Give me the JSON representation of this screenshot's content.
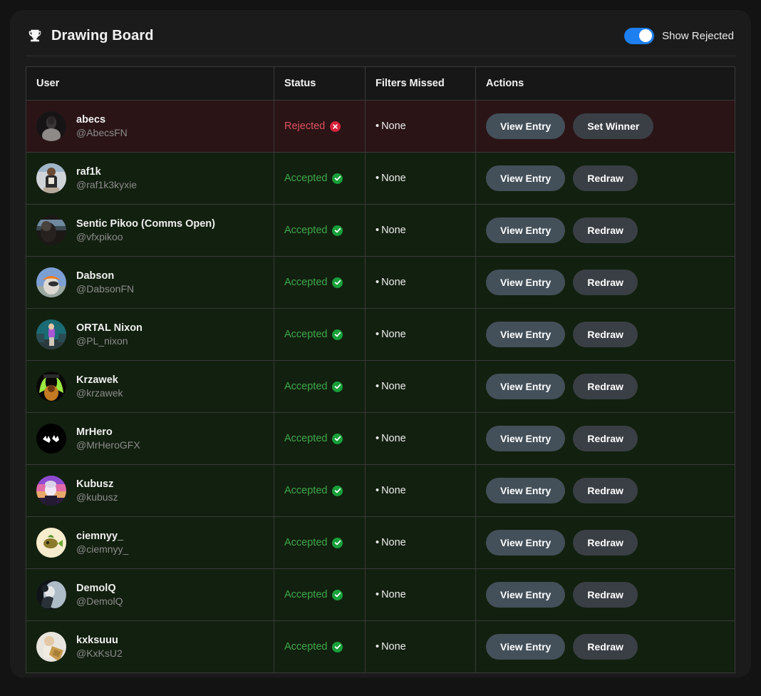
{
  "header": {
    "icon": "trophy-icon",
    "title": "Drawing Board",
    "toggle": {
      "label": "Show Rejected",
      "enabled": true,
      "accent_color": "#1d7ff0"
    }
  },
  "table": {
    "columns": [
      "User",
      "Status",
      "Filters Missed",
      "Actions"
    ],
    "rows": [
      {
        "name": "abecs",
        "handle": "@AbecsFN",
        "status": "Rejected",
        "status_state": "rejected",
        "status_icon": "circle-x-icon",
        "filters_missed": "None",
        "buttons": [
          "View Entry",
          "Set Winner"
        ],
        "avatar": "avatar-abecs"
      },
      {
        "name": "raf1k",
        "handle": "@raf1k3kyxie",
        "status": "Accepted",
        "status_state": "accepted",
        "status_icon": "circle-check-icon",
        "filters_missed": "None",
        "buttons": [
          "View Entry",
          "Redraw"
        ],
        "avatar": "avatar-raf1k"
      },
      {
        "name": "Sentic Pikoo (Comms Open)",
        "handle": "@vfxpikoo",
        "status": "Accepted",
        "status_state": "accepted",
        "status_icon": "circle-check-icon",
        "filters_missed": "None",
        "buttons": [
          "View Entry",
          "Redraw"
        ],
        "avatar": "avatar-pikoo"
      },
      {
        "name": "Dabson",
        "handle": "@DabsonFN",
        "status": "Accepted",
        "status_state": "accepted",
        "status_icon": "circle-check-icon",
        "filters_missed": "None",
        "buttons": [
          "View Entry",
          "Redraw"
        ],
        "avatar": "avatar-dabson"
      },
      {
        "name": "ORTAL Nixon",
        "handle": "@PL_nixon",
        "status": "Accepted",
        "status_state": "accepted",
        "status_icon": "circle-check-icon",
        "filters_missed": "None",
        "buttons": [
          "View Entry",
          "Redraw"
        ],
        "avatar": "avatar-ortal"
      },
      {
        "name": "Krzawek",
        "handle": "@krzawek",
        "status": "Accepted",
        "status_state": "accepted",
        "status_icon": "circle-check-icon",
        "filters_missed": "None",
        "buttons": [
          "View Entry",
          "Redraw"
        ],
        "avatar": "avatar-krzawek"
      },
      {
        "name": "MrHero",
        "handle": "@MrHeroGFX",
        "status": "Accepted",
        "status_state": "accepted",
        "status_icon": "circle-check-icon",
        "filters_missed": "None",
        "buttons": [
          "View Entry",
          "Redraw"
        ],
        "avatar": "avatar-mrhero"
      },
      {
        "name": "Kubusz",
        "handle": "@kubusz",
        "status": "Accepted",
        "status_state": "accepted",
        "status_icon": "circle-check-icon",
        "filters_missed": "None",
        "buttons": [
          "View Entry",
          "Redraw"
        ],
        "avatar": "avatar-kubusz"
      },
      {
        "name": "ciemnyy_",
        "handle": "@ciemnyy_",
        "status": "Accepted",
        "status_state": "accepted",
        "status_icon": "circle-check-icon",
        "filters_missed": "None",
        "buttons": [
          "View Entry",
          "Redraw"
        ],
        "avatar": "avatar-ciemnyy"
      },
      {
        "name": "DemolQ",
        "handle": "@DemolQ",
        "status": "Accepted",
        "status_state": "accepted",
        "status_icon": "circle-check-icon",
        "filters_missed": "None",
        "buttons": [
          "View Entry",
          "Redraw"
        ],
        "avatar": "avatar-demolq"
      },
      {
        "name": "kxksuuu",
        "handle": "@KxKsU2",
        "status": "Accepted",
        "status_state": "accepted",
        "status_icon": "circle-check-icon",
        "filters_missed": "None",
        "buttons": [
          "View Entry",
          "Redraw"
        ],
        "avatar": "avatar-kxksuuu"
      }
    ]
  },
  "colors": {
    "accepted": "#3fa84b",
    "rejected": "#e0525e",
    "accepted_row_bg": "#12200f",
    "rejected_row_bg": "#2a1416",
    "toggle_on": "#1d7ff0",
    "button_bg": "#43505a"
  }
}
